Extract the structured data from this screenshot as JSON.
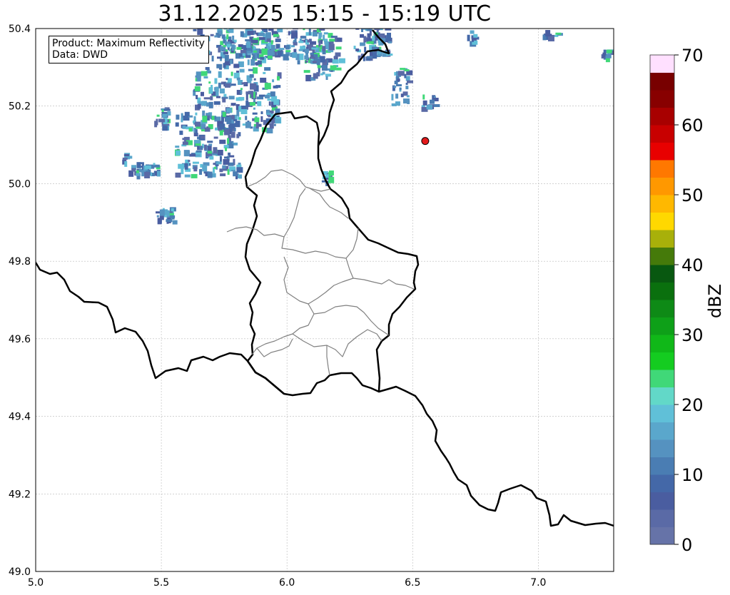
{
  "title": "31.12.2025 15:15 - 15:19 UTC",
  "info": {
    "product_line": "Product: Maximum Reflectivity",
    "data_line": "Data: DWD"
  },
  "map": {
    "lon_range": [
      5.0,
      7.3
    ],
    "lat_range": [
      49.0,
      50.4
    ],
    "x_ticks": [
      "5.0",
      "5.5",
      "6.0",
      "6.5",
      "7.0"
    ],
    "y_ticks": [
      "49.0",
      "49.2",
      "49.4",
      "49.6",
      "49.8",
      "50.0",
      "50.2",
      "50.4"
    ],
    "grid": true,
    "marker": {
      "lon": 6.55,
      "lat": 50.11,
      "color": "#e31a1c"
    }
  },
  "colorbar": {
    "label": "dBZ",
    "ticks": [
      "0",
      "10",
      "20",
      "30",
      "40",
      "50",
      "60",
      "70"
    ],
    "range": [
      0,
      70
    ],
    "step": 2.5,
    "colors": [
      "#6673a8",
      "#5a6aa6",
      "#4a5da0",
      "#4468a8",
      "#4a7db3",
      "#5592c0",
      "#5aa7cc",
      "#60c0d8",
      "#62d8c8",
      "#40d878",
      "#14cc20",
      "#10b818",
      "#0ea018",
      "#0e8a16",
      "#0a700e",
      "#085810",
      "#457a0a",
      "#a8b00a",
      "#ffd800",
      "#ffb800",
      "#ff9800",
      "#ff7800",
      "#e80000",
      "#c80000",
      "#a80000",
      "#880000",
      "#780000",
      "#ffe0ff",
      "#ffb0ff",
      "#ff70ff",
      "#ff40ff",
      "#f030f0"
    ]
  }
}
